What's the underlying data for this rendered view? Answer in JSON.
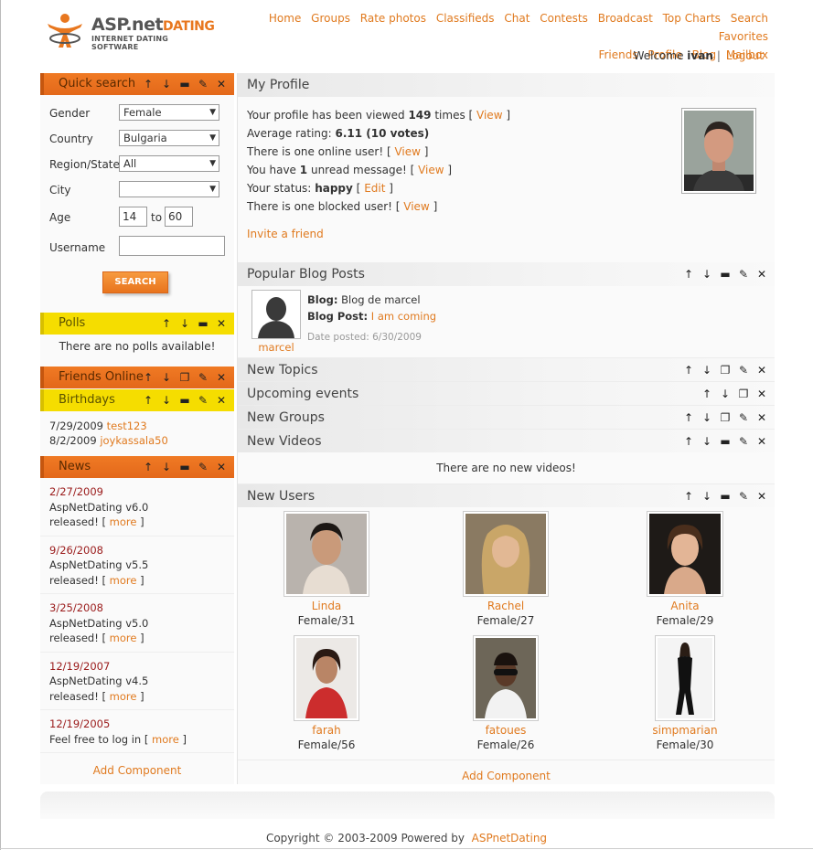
{
  "logo": {
    "brand_main": "ASP.net",
    "brand_accent": "DATING",
    "tagline": "INTERNET DATING SOFTWARE"
  },
  "nav": {
    "row1": [
      "Home",
      "Groups",
      "Rate photos",
      "Classifieds",
      "Chat",
      "Contests",
      "Broadcast",
      "Top Charts",
      "Search",
      "Favorites"
    ],
    "row2": [
      "Friends",
      "Profile",
      "Blog",
      "Mailbox"
    ]
  },
  "welcome": {
    "prefix": "Welcome",
    "user": "ivan",
    "sep": "|",
    "logout": "Logout"
  },
  "quick_search": {
    "title": "Quick search",
    "gender_label": "Gender",
    "gender_value": "Female",
    "country_label": "Country",
    "country_value": "Bulgaria",
    "region_label": "Region/State",
    "region_value": "All",
    "city_label": "City",
    "city_value": "",
    "age_label": "Age",
    "age_from": "14",
    "age_to_label": "to",
    "age_to": "60",
    "username_label": "Username",
    "username_value": "",
    "button": "SEARCH"
  },
  "polls": {
    "title": "Polls",
    "empty": "There are no polls available!"
  },
  "friends_online": {
    "title": "Friends Online"
  },
  "birthdays": {
    "title": "Birthdays",
    "items": [
      {
        "date": "7/29/2009",
        "user": "test123"
      },
      {
        "date": "8/2/2009",
        "user": "joykassala50"
      }
    ]
  },
  "news": {
    "title": "News",
    "items": [
      {
        "date": "2/27/2009",
        "line1": "AspNetDating v6.0",
        "line2": "released! [",
        "more": "more",
        "close": "]"
      },
      {
        "date": "9/26/2008",
        "line1": "AspNetDating v5.5",
        "line2": "released! [",
        "more": "more",
        "close": "]"
      },
      {
        "date": "3/25/2008",
        "line1": "AspNetDating v5.0",
        "line2": "released! [",
        "more": "more",
        "close": "]"
      },
      {
        "date": "12/19/2007",
        "line1": "AspNetDating v4.5",
        "line2": "released! [",
        "more": "more",
        "close": "]"
      },
      {
        "date": "12/19/2005",
        "line1": "Feel free to log in [",
        "line2": "",
        "more": "more",
        "close": "]"
      }
    ]
  },
  "left_add_component": "Add Component",
  "profile": {
    "title": "My Profile",
    "l1_pre": "Your profile has been viewed",
    "l1_num": "149",
    "l1_post": "times [",
    "l1_link": "View",
    "l1_close": "]",
    "l2_pre": "Average rating:",
    "l2_val": "6.11 (10 votes)",
    "l3_pre": "There is one online user! [",
    "l3_link": "View",
    "l3_close": "]",
    "l4_pre": "You have",
    "l4_num": "1",
    "l4_post": "unread message! [",
    "l4_link": "View",
    "l4_close": "]",
    "l5_pre": "Your status:",
    "l5_val": "happy",
    "l5_open": "[",
    "l5_link": "Edit",
    "l5_close": "]",
    "l6_pre": "There is one blocked user! [",
    "l6_link": "View",
    "l6_close": "]",
    "invite": "Invite a friend"
  },
  "blog_posts": {
    "title": "Popular Blog Posts",
    "author": "marcel",
    "blog_label": "Blog:",
    "blog_value": "Blog de marcel",
    "post_label": "Blog Post:",
    "post_value": "I am coming",
    "date_label": "Date posted: 6/30/2009"
  },
  "sections": {
    "new_topics": "New Topics",
    "upcoming_events": "Upcoming events",
    "new_groups": "New Groups",
    "new_videos": "New Videos",
    "no_videos": "There are no new videos!",
    "new_users": "New Users"
  },
  "users": [
    {
      "name": "Linda",
      "info": "Female/31"
    },
    {
      "name": "Rachel",
      "info": "Female/27"
    },
    {
      "name": "Anita",
      "info": "Female/29"
    },
    {
      "name": "farah",
      "info": "Female/56"
    },
    {
      "name": "fatoues",
      "info": "Female/26"
    },
    {
      "name": "simpmarian",
      "info": "Female/30"
    }
  ],
  "main_add_component": "Add Component",
  "footer": {
    "copyright": "Copyright © 2003-2009 Powered by",
    "link": "ASPnetDating"
  },
  "colors": {
    "accent": "#e07a1f",
    "orange_header": "#ec7220",
    "yellow_header": "#f5dd00",
    "news_date": "#9a1a1a"
  }
}
